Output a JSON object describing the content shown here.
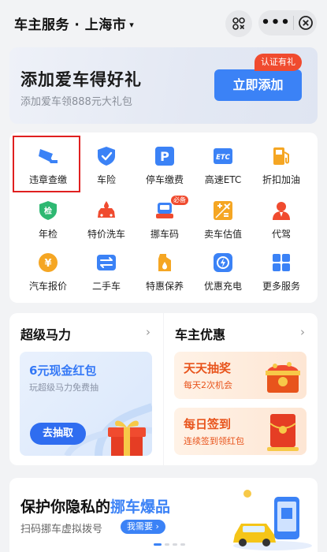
{
  "header": {
    "title": "车主服务 · 上海市",
    "caret": "▾",
    "more": "•••"
  },
  "banner": {
    "title": "添加爱车得好礼",
    "subtitle": "添加爱车领888元大礼包",
    "button": "立即添加",
    "badge": "认证有礼"
  },
  "services": [
    {
      "label": "违章查缴",
      "icon": "camera-icon"
    },
    {
      "label": "车险",
      "icon": "shield-icon"
    },
    {
      "label": "停车缴费",
      "icon": "parking-icon"
    },
    {
      "label": "高速ETC",
      "icon": "etc-icon"
    },
    {
      "label": "折扣加油",
      "icon": "fuel-pump-icon"
    },
    {
      "label": "年检",
      "icon": "inspection-icon"
    },
    {
      "label": "特价洗车",
      "icon": "car-wash-icon"
    },
    {
      "label": "挪车码",
      "icon": "move-car-icon",
      "badge": "必备"
    },
    {
      "label": "卖车估值",
      "icon": "valuation-icon"
    },
    {
      "label": "代驾",
      "icon": "driver-icon"
    },
    {
      "label": "汽车报价",
      "icon": "price-icon"
    },
    {
      "label": "二手车",
      "icon": "used-car-icon"
    },
    {
      "label": "特惠保养",
      "icon": "oil-icon"
    },
    {
      "label": "优惠充电",
      "icon": "charging-icon"
    },
    {
      "label": "更多服务",
      "icon": "grid-icon"
    }
  ],
  "inspection_glyph": "检",
  "price_glyph": "¥",
  "etc_glyph": "ETC",
  "parking_glyph": "P",
  "super_power": {
    "title": "超级马力",
    "card_title": "6元现金红包",
    "card_sub": "玩超级马力免费抽",
    "button": "去抽取"
  },
  "owner_deals": {
    "title": "车主优惠",
    "items": [
      {
        "title": "天天抽奖",
        "sub": "每天2次机会"
      },
      {
        "title": "每日签到",
        "sub": "连续签到领红包"
      }
    ]
  },
  "bottom_banner": {
    "title_prefix": "保护你隐私的",
    "title_highlight": "挪车爆品",
    "subtitle": "扫码挪车虚拟拨号",
    "button": "我需要 ›"
  },
  "chevron": "›",
  "colors": {
    "accent": "#3b82f6",
    "badge_red": "#f04b2f",
    "orange": "#f5a623"
  }
}
